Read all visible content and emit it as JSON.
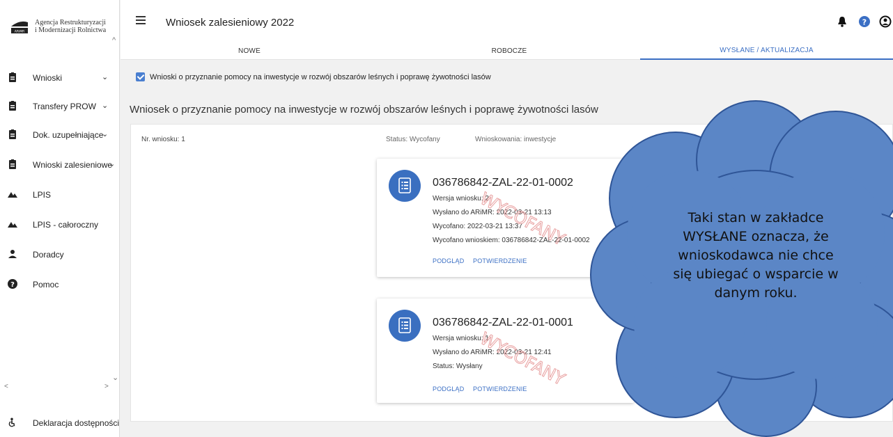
{
  "app": {
    "org_line1": "Agencja Restrukturyzacji",
    "org_line2": "i Modernizacji Rolnictwa",
    "logo_abbr": "ARiMR",
    "title": "Wniosek zalesieniowy 2022"
  },
  "sidebar": {
    "items": [
      {
        "label": "Wnioski",
        "icon": "clipboard-icon",
        "has_chevron": true
      },
      {
        "label": "Transfery PROW",
        "icon": "clipboard-icon",
        "has_chevron": true
      },
      {
        "label": "Dok. uzupełniające",
        "icon": "clipboard-icon",
        "has_chevron": true
      },
      {
        "label": "Wnioski zalesieniowe",
        "icon": "clipboard-icon",
        "has_chevron": true
      },
      {
        "label": "LPIS",
        "icon": "mountains-icon",
        "has_chevron": false
      },
      {
        "label": "LPIS - całoroczny",
        "icon": "mountains-icon",
        "has_chevron": false
      },
      {
        "label": "Doradcy",
        "icon": "person-icon",
        "has_chevron": false
      },
      {
        "label": "Pomoc",
        "icon": "help-circle-icon",
        "has_chevron": false
      }
    ],
    "accessibility": "Deklaracja dostępności"
  },
  "header_icons": [
    "bell-icon",
    "help-icon",
    "account-icon"
  ],
  "tabs": [
    {
      "label": "NOWE",
      "active": false
    },
    {
      "label": "ROBOCZE",
      "active": false
    },
    {
      "label": "WYSŁANE / AKTUALIZACJA",
      "active": true
    }
  ],
  "filter": {
    "label": "Wnioski o przyznanie pomocy na inwestycje w rozwój obszarów leśnych i poprawę żywotności lasów",
    "checked": true
  },
  "section_title": "Wniosek o przyznanie pomocy na inwestycje w rozwój obszarów leśnych i poprawę żywotności lasów",
  "application_row": {
    "number": "Nr. wniosku: 1",
    "status": "Status: Wycofany",
    "type": "Wnioskowania: inwestycje"
  },
  "cards": [
    {
      "number": "036786842-ZAL-22-01-0002",
      "lines": [
        "Wersja wniosku: 2",
        "Wysłano do ARiMR: 2022-03-21 13:13",
        "Wycofano: 2022-03-21 13:37",
        "Wycofano wnioskiem: 036786842-ZAL-22-01-0002"
      ],
      "preview": "PODGLĄD",
      "confirmation": "POTWIERDZENIE",
      "stamp": "WYCOFANY"
    },
    {
      "number": "036786842-ZAL-22-01-0001",
      "lines": [
        "Wersja wniosku: 1",
        "Wysłano do ARiMR: 2022-03-21 12:41",
        "Status: Wysłany"
      ],
      "preview": "PODGLĄD",
      "confirmation": "POTWIERDZENIE",
      "stamp": "WYCOFANY"
    }
  ],
  "annotation": {
    "lines": [
      "Taki stan w zakładce",
      "WYSŁANE oznacza, że",
      "wnioskodawca nie chce",
      "się ubiegać o wsparcie w",
      "danym roku."
    ],
    "fill": "#5b86c6",
    "stroke": "#2f5597"
  },
  "colors": {
    "accent": "#3b6fc4",
    "stamp": "#e8a0a0"
  }
}
